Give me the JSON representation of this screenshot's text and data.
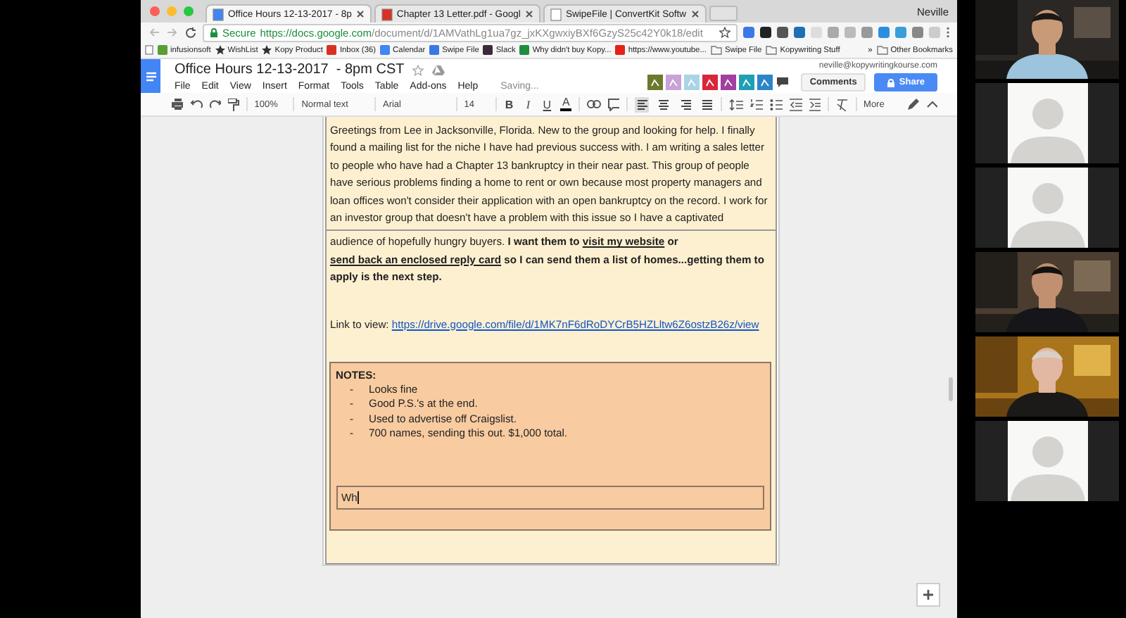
{
  "browser": {
    "tabs": [
      {
        "title": "Office Hours 12-13-2017 - 8p",
        "selected": true
      },
      {
        "title": "Chapter 13 Letter.pdf - Googl",
        "selected": false
      },
      {
        "title": "SwipeFile | ConvertKit Softw",
        "selected": false
      }
    ],
    "user": "Neville",
    "secure_label": "Secure",
    "url_host": "https://docs.google.com",
    "url_path": "/document/d/1AMVathLg1ua7gz_jxKXgwxiyBXf6GzyS25c42Y0k18/edit",
    "extensions": [
      {
        "color": "#3b78e7"
      },
      {
        "color": "#222222"
      },
      {
        "color": "#555555"
      },
      {
        "color": "#1f6fb5"
      },
      {
        "color": "#dddddd"
      },
      {
        "color": "#aaaaaa"
      },
      {
        "color": "#bbbbbb"
      },
      {
        "color": "#999999"
      },
      {
        "color": "#2a8ee0"
      },
      {
        "color": "#3a9fd8"
      },
      {
        "color": "#888888"
      },
      {
        "color": "#cccccc"
      }
    ],
    "bookmarks": [
      {
        "label": "infusionsoft",
        "kind": "site",
        "color": "#5a9e32"
      },
      {
        "label": "WishList",
        "kind": "star"
      },
      {
        "label": "Kopy Product",
        "kind": "star"
      },
      {
        "label": "Inbox (36)",
        "kind": "site",
        "color": "#d93025"
      },
      {
        "label": "Calendar",
        "kind": "site",
        "color": "#4285f4"
      },
      {
        "label": "Swipe File",
        "kind": "site",
        "color": "#3b78e7"
      },
      {
        "label": "Slack",
        "kind": "site",
        "color": "#3a2a3a"
      },
      {
        "label": "Why didn't buy Kopy...",
        "kind": "site",
        "color": "#1e8e3e"
      },
      {
        "label": "https://www.youtube...",
        "kind": "site",
        "color": "#e62117"
      },
      {
        "label": "Swipe File",
        "kind": "folder"
      },
      {
        "label": "Kopywriting Stuff",
        "kind": "folder"
      }
    ],
    "overflow": "»",
    "other_bookmarks": "Other Bookmarks"
  },
  "docs": {
    "title": "Office Hours 12-13-2017  - 8pm CST",
    "menu": [
      "File",
      "Edit",
      "View",
      "Insert",
      "Format",
      "Tools",
      "Table",
      "Add-ons",
      "Help"
    ],
    "status": "Saving...",
    "account": "neville@kopywritingkourse.com",
    "addons": [
      {
        "color": "#6b7a2c"
      },
      {
        "color": "#c7a3d9"
      },
      {
        "color": "#a9d4e6"
      },
      {
        "color": "#d9263a"
      },
      {
        "color": "#a23fa0"
      },
      {
        "color": "#1f9fb5"
      },
      {
        "color": "#2b86c9"
      }
    ],
    "comments": "Comments",
    "share": "Share"
  },
  "toolbar": {
    "zoom": "100%",
    "style": "Normal text",
    "font": "Arial",
    "size": "14",
    "format": [
      "B",
      "I",
      "U",
      "A"
    ],
    "alignment": [
      {
        "selected": true
      },
      {
        "selected": false
      },
      {
        "selected": false
      },
      {
        "selected": false
      }
    ],
    "more": "More"
  },
  "document": {
    "paragraph_1": "Greetings from Lee in Jacksonville, Florida. New to the group and looking for help. I finally found a mailing list for the niche I have had previous success with. I am writing a sales letter to people who have had a Chapter 13 bankruptcy in their near past. This group of people have serious problems finding a home to rent or own because most property managers and loan offices won't consider their application with an open bankruptcy on the record. I work for an investor group that doesn't have a problem with this issue so I have a captivated",
    "paragraph_2": [
      {
        "text": "audience of hopefully hungry buyers. ",
        "kind": "plain"
      },
      {
        "text": "I want them to ",
        "kind": "bold"
      },
      {
        "text": "visit my website",
        "kind": "link"
      },
      {
        "text": " or ",
        "kind": "bold"
      },
      {
        "text": "send back an enclosed reply card",
        "kind": "link"
      },
      {
        "text": " so I can send them a list of homes...getting them to apply is the next step.",
        "kind": "bold"
      }
    ],
    "link_label": "Link to view:",
    "link_url": "https://drive.google.com/file/d/1MK7nF6dRoDYCrB5HZLltw6Z6ostzB26z/view",
    "notes": {
      "title": "NOTES:",
      "items": [
        {
          "text": "Looks fine"
        },
        {
          "text": "Good P.S.'s at the end."
        },
        {
          "text": "Used to advertise off Craigslist."
        },
        {
          "text": "700 names, sending this out.  $1,000 total."
        }
      ],
      "bullet": "-",
      "input": "Wh"
    }
  },
  "participants": [
    {
      "kind": "camera"
    },
    {
      "kind": "avatar"
    },
    {
      "kind": "avatar"
    },
    {
      "kind": "camera"
    },
    {
      "kind": "camera"
    },
    {
      "kind": "avatar"
    }
  ]
}
